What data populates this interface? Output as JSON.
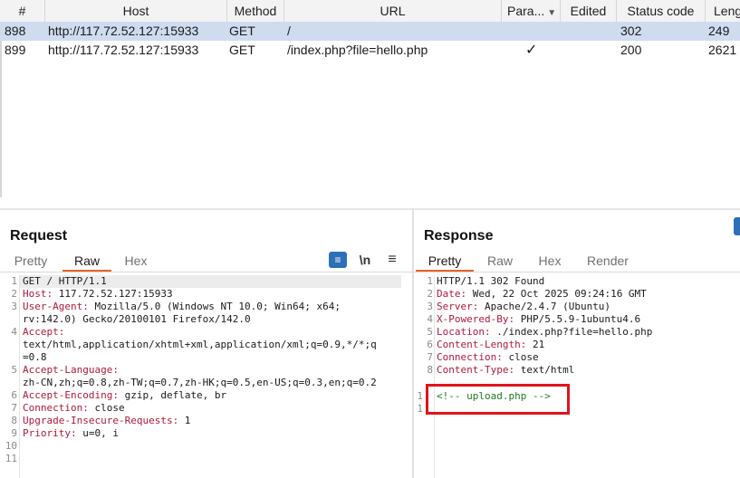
{
  "table": {
    "headers": [
      {
        "key": "num",
        "label": "#"
      },
      {
        "key": "host",
        "label": "Host"
      },
      {
        "key": "method",
        "label": "Method"
      },
      {
        "key": "url",
        "label": "URL"
      },
      {
        "key": "params",
        "label": "Para..."
      },
      {
        "key": "edited",
        "label": "Edited"
      },
      {
        "key": "status",
        "label": "Status code"
      },
      {
        "key": "length",
        "label": "Leng"
      }
    ],
    "rows": [
      {
        "num": "898",
        "host": "http://117.72.52.127:15933",
        "method": "GET",
        "url": "/",
        "params": "",
        "edited": "",
        "status": "302",
        "length": "249",
        "selected": true
      },
      {
        "num": "899",
        "host": "http://117.72.52.127:15933",
        "method": "GET",
        "url": "/index.php?file=hello.php",
        "params": "✓",
        "edited": "",
        "status": "200",
        "length": "2621",
        "selected": false
      }
    ]
  },
  "request": {
    "title": "Request",
    "tabs": [
      "Pretty",
      "Raw",
      "Hex"
    ],
    "active_tab": "Raw",
    "tools": {
      "wrap": "≡",
      "newline": "\\n",
      "menu": "≡"
    },
    "lines": [
      {
        "n": "1",
        "key": "",
        "text": "GET / HTTP/1.1"
      },
      {
        "n": "2",
        "key": "Host:",
        "text": " 117.72.52.127:15933"
      },
      {
        "n": "3",
        "key": "User-Agent:",
        "text": " Mozilla/5.0 (Windows NT 10.0; Win64; x64;"
      },
      {
        "n": "",
        "key": "",
        "text": "rv:142.0) Gecko/20100101 Firefox/142.0"
      },
      {
        "n": "4",
        "key": "Accept:",
        "text": ""
      },
      {
        "n": "",
        "key": "",
        "text": "text/html,application/xhtml+xml,application/xml;q=0.9,*/*;q"
      },
      {
        "n": "",
        "key": "",
        "text": "=0.8"
      },
      {
        "n": "5",
        "key": "Accept-Language:",
        "text": ""
      },
      {
        "n": "",
        "key": "",
        "text": "zh-CN,zh;q=0.8,zh-TW;q=0.7,zh-HK;q=0.5,en-US;q=0.3,en;q=0.2"
      },
      {
        "n": "6",
        "key": "Accept-Encoding:",
        "text": " gzip, deflate, br"
      },
      {
        "n": "7",
        "key": "Connection:",
        "text": " close"
      },
      {
        "n": "8",
        "key": "Upgrade-Insecure-Requests:",
        "text": " 1"
      },
      {
        "n": "9",
        "key": "Priority:",
        "text": " u=0, i"
      },
      {
        "n": "10",
        "key": "",
        "text": ""
      },
      {
        "n": "11",
        "key": "",
        "text": ""
      }
    ]
  },
  "response": {
    "title": "Response",
    "tabs": [
      "Pretty",
      "Raw",
      "Hex",
      "Render"
    ],
    "active_tab": "Pretty",
    "lines": [
      {
        "n": "1",
        "key": "",
        "text": "HTTP/1.1 302 Found"
      },
      {
        "n": "2",
        "key": "Date:",
        "text": " Wed, 22 Oct 2025 09:24:16 GMT"
      },
      {
        "n": "3",
        "key": "Server:",
        "text": " Apache/2.4.7 (Ubuntu)"
      },
      {
        "n": "4",
        "key": "X-Powered-By:",
        "text": " PHP/5.5.9-1ubuntu4.6"
      },
      {
        "n": "5",
        "key": "Location:",
        "text": " ./index.php?file=hello.php"
      },
      {
        "n": "6",
        "key": "Content-Length:",
        "text": " 21"
      },
      {
        "n": "7",
        "key": "Connection:",
        "text": " close"
      },
      {
        "n": "8",
        "key": "Content-Type:",
        "text": " text/html"
      }
    ],
    "body_line_numbers": [
      "1",
      "1"
    ],
    "body_comment": "<!-- upload.php -->",
    "highlight_color": "#e1141b"
  },
  "colors": {
    "accent": "#e8622c",
    "selection": "#cfdcf0",
    "header_key": "#b0193c",
    "comment": "#217a21",
    "wrap_button": "#2d6fb8"
  }
}
